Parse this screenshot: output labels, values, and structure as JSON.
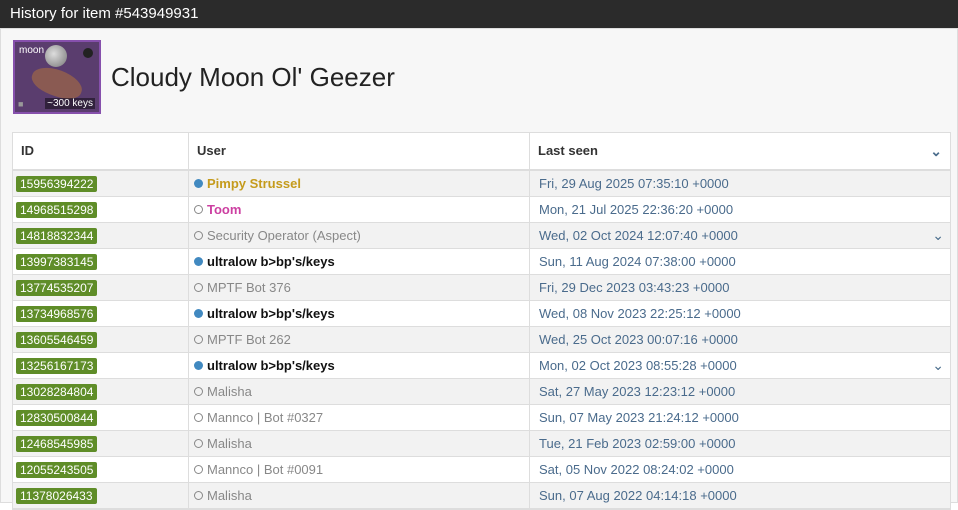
{
  "window": {
    "title": "History for item #543949931"
  },
  "item": {
    "image_tag": "moon",
    "keys": "~300 keys",
    "name": "Cloudy Moon Ol' Geezer",
    "border_color": "#8650ac"
  },
  "table": {
    "headers": {
      "id": "ID",
      "user": "User",
      "last_seen": "Last seen"
    },
    "rows": [
      {
        "id": "15956394222",
        "user": "Pimpy Strussel",
        "online": true,
        "style": "gold",
        "last_seen": "Fri, 29 Aug 2025 07:35:10 +0000",
        "chevron": false
      },
      {
        "id": "14968515298",
        "user": "Toom",
        "online": false,
        "style": "pink",
        "last_seen": "Mon, 21 Jul 2025 22:36:20 +0000",
        "chevron": false
      },
      {
        "id": "14818832344",
        "user": "Security Operator (Aspect)",
        "online": false,
        "style": "gray",
        "last_seen": "Wed, 02 Oct 2024 12:07:40 +0000",
        "chevron": true
      },
      {
        "id": "13997383145",
        "user": "ultralow b>bp's/keys",
        "online": true,
        "style": "bold",
        "last_seen": "Sun, 11 Aug 2024 07:38:00 +0000",
        "chevron": false
      },
      {
        "id": "13774535207",
        "user": "MPTF Bot 376",
        "online": false,
        "style": "gray",
        "last_seen": "Fri, 29 Dec 2023 03:43:23 +0000",
        "chevron": false
      },
      {
        "id": "13734968576",
        "user": "ultralow b>bp's/keys",
        "online": true,
        "style": "bold",
        "last_seen": "Wed, 08 Nov 2023 22:25:12 +0000",
        "chevron": false
      },
      {
        "id": "13605546459",
        "user": "MPTF Bot 262",
        "online": false,
        "style": "gray",
        "last_seen": "Wed, 25 Oct 2023 00:07:16 +0000",
        "chevron": false
      },
      {
        "id": "13256167173",
        "user": "ultralow b>bp's/keys",
        "online": true,
        "style": "bold",
        "last_seen": "Mon, 02 Oct 2023 08:55:28 +0000",
        "chevron": true
      },
      {
        "id": "13028284804",
        "user": "Malisha",
        "online": false,
        "style": "gray",
        "last_seen": "Sat, 27 May 2023 12:23:12 +0000",
        "chevron": false
      },
      {
        "id": "12830500844",
        "user": "Mannco | Bot #0327",
        "online": false,
        "style": "gray",
        "last_seen": "Sun, 07 May 2023 21:24:12 +0000",
        "chevron": false
      },
      {
        "id": "12468545985",
        "user": "Malisha",
        "online": false,
        "style": "gray",
        "last_seen": "Tue, 21 Feb 2023 02:59:00 +0000",
        "chevron": false
      },
      {
        "id": "12055243505",
        "user": "Mannco | Bot #0091",
        "online": false,
        "style": "gray",
        "last_seen": "Sat, 05 Nov 2022 08:24:02 +0000",
        "chevron": false
      },
      {
        "id": "11378026433",
        "user": "Malisha",
        "online": false,
        "style": "gray",
        "last_seen": "Sun, 07 Aug 2022 04:14:18 +0000",
        "chevron": false
      }
    ]
  }
}
